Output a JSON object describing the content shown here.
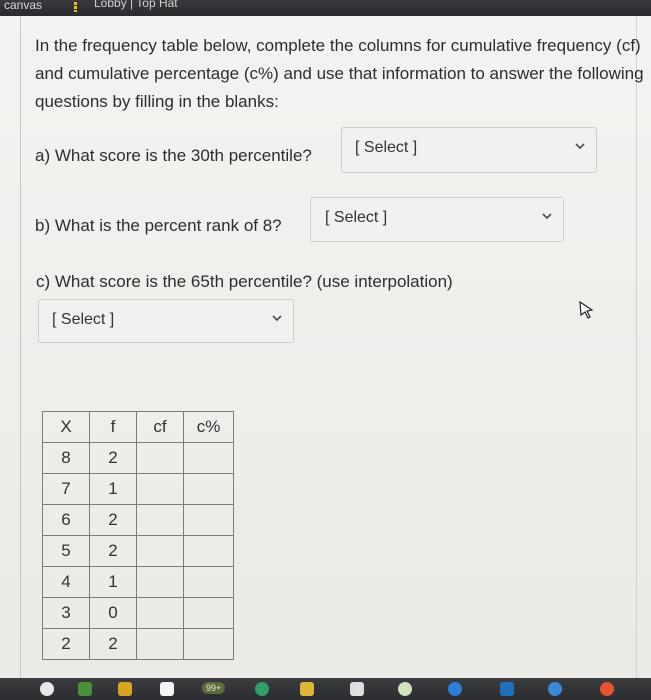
{
  "browser": {
    "tab1": "canvas",
    "tab2": "Lobby | Top Hat"
  },
  "question": {
    "intro": "In the frequency table below, complete the columns for cumulative frequency (cf) and cumulative percentage (c%) and use that information to answer the following questions by filling in the blanks:",
    "a_text": "a) What score is the 30th percentile?",
    "a_select": "[ Select ]",
    "b_text": "b) What is the percent rank of 8?",
    "b_select": "[ Select ]",
    "c_text": "c) What score is the 65th percentile? (use interpolation)",
    "c_select": "[ Select ]"
  },
  "table": {
    "headers": [
      "X",
      "f",
      "cf",
      "c%"
    ],
    "rows": [
      {
        "x": "8",
        "f": "2",
        "cf": "",
        "cp": ""
      },
      {
        "x": "7",
        "f": "1",
        "cf": "",
        "cp": ""
      },
      {
        "x": "6",
        "f": "2",
        "cf": "",
        "cp": ""
      },
      {
        "x": "5",
        "f": "2",
        "cf": "",
        "cp": ""
      },
      {
        "x": "4",
        "f": "1",
        "cf": "",
        "cp": ""
      },
      {
        "x": "3",
        "f": "0",
        "cf": "",
        "cp": ""
      },
      {
        "x": "2",
        "f": "2",
        "cf": "",
        "cp": ""
      }
    ]
  },
  "dock": {
    "badge": "99+"
  }
}
